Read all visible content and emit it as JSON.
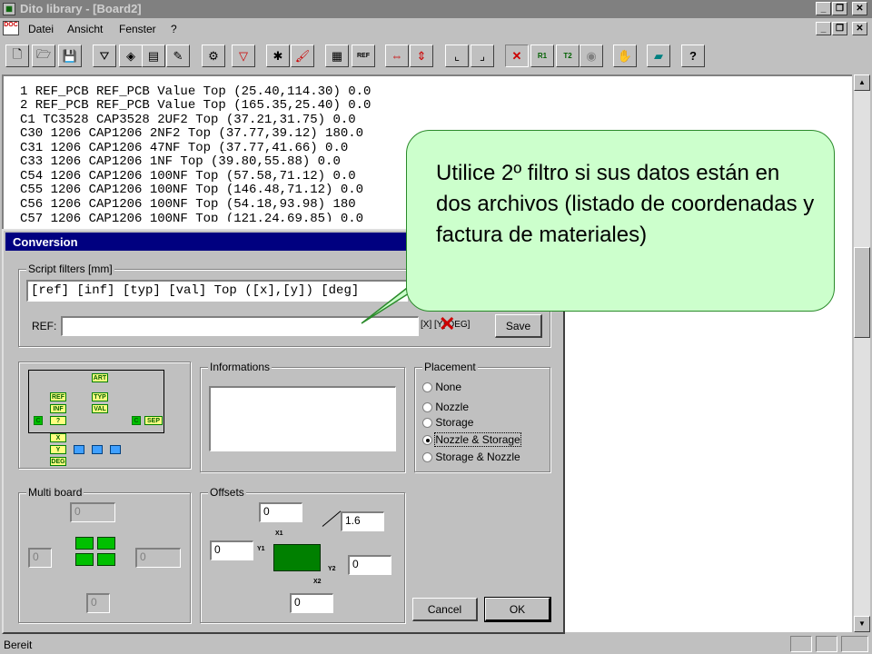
{
  "app": {
    "title": "Dito library - [Board2]",
    "doc_icon_label": "DOC"
  },
  "menu": [
    "Datei",
    "Ansicht",
    "Fenster",
    "?"
  ],
  "toolbar_icons": [
    "new-file-icon",
    "open-folder-icon",
    "save-disk-icon",
    "filter-icon",
    "components-icon",
    "library-icon",
    "edit-component-icon",
    "settings-icon",
    "funnel-icon",
    "magic-wand-icon",
    "paint-brush-icon",
    "grid-icon",
    "ref-icon",
    "move-horizontal-icon",
    "move-vertical-icon",
    "select-x-icon",
    "select-y-icon",
    "delete-icon",
    "rotate-r1-icon",
    "mirror-icon",
    "view-eye-icon",
    "hand-icon",
    "eraser-icon",
    "help-icon"
  ],
  "toolbar_text": {
    "ref": "REF",
    "r1": "R1",
    "t2": "T2"
  },
  "listing": [
    "1 REF_PCB REF_PCB Value Top (25.40,114.30) 0.0",
    "2 REF_PCB REF_PCB Value Top (165.35,25.40) 0.0",
    "C1 TC3528 CAP3528 2UF2 Top (37.21,31.75) 0.0",
    "C30 1206 CAP1206 2NF2 Top (37.77,39.12) 180.0",
    "C31 1206 CAP1206 47NF Top (37.77,41.66) 0.0",
    "C33 1206 CAP1206 1NF Top (39.80,55.88) 0.0",
    "C54 1206 CAP1206 100NF Top (57.58,71.12) 0.0",
    "C55 1206 CAP1206 100NF Top (146.48,71.12) 0.0",
    "C56 1206 CAP1206 100NF Top (54.18,93.98) 180",
    "C57 1206 CAP1206 100NF Top (121.24,69.85) 0.0"
  ],
  "dialog": {
    "title": "Conversion",
    "script_filters_label": "Script filters [mm]",
    "script_filter_value": "[ref] [inf] [typ] [val] Top ([x],[y]) [deg]",
    "ref_label": "REF:",
    "ref_value": "",
    "coord_legend": "[X] [Y] DEG]",
    "save_label": "Save",
    "informations_label": "Informations",
    "informations_value": "",
    "placement_label": "Placement",
    "placement_options": [
      "None",
      "Nozzle",
      "Storage",
      "Nozzle & Storage",
      "Storage & Nozzle"
    ],
    "placement_selected": "Nozzle & Storage",
    "multiboard_label": "Multi board",
    "multiboard_values": [
      "0",
      "0",
      "0",
      "0"
    ],
    "offsets_label": "Offsets",
    "offset_values": {
      "top": "0",
      "angle": "1.6",
      "left": "0",
      "right": "0",
      "bottom": "0"
    },
    "offset_diagram": {
      "x1": "X1",
      "y1": "Y1",
      "y2": "Y2",
      "x2": "X2"
    },
    "cancel_label": "Cancel",
    "ok_label": "OK",
    "flow_boxes": [
      "ART",
      "TYP",
      "VAL",
      "REF",
      "INF",
      "?",
      "X",
      "Y",
      "DEG",
      "SEP",
      "C",
      "C"
    ]
  },
  "callout": {
    "text": "Utilice 2º filtro si sus datos están en dos archivos (listado de coordenadas  y factura de materiales)",
    "color": "#ccffcc"
  },
  "status": {
    "text": "Bereit"
  },
  "colors": {
    "titlebar": "#808080",
    "callout_fill": "#ccffcc",
    "callout_border": "#2a8a2a",
    "dialog_title": "#000080",
    "x_mark": "#cc0000"
  }
}
